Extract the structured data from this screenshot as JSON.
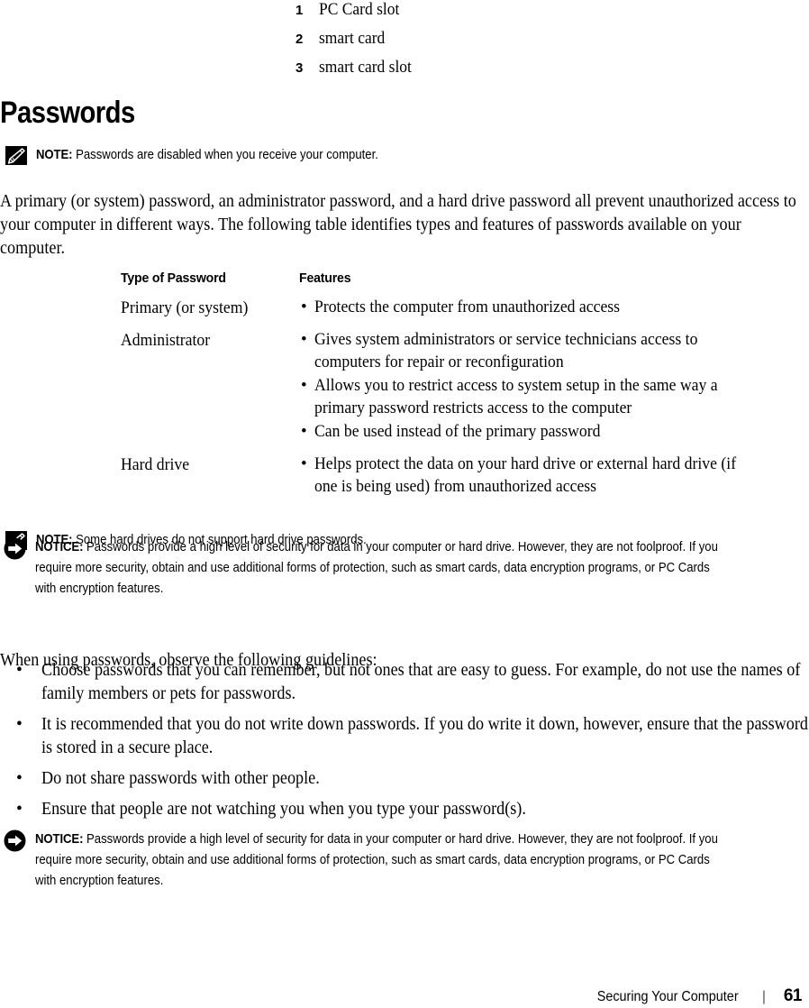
{
  "legend": {
    "items": [
      {
        "num": "1",
        "label": "PC Card slot"
      },
      {
        "num": "2",
        "label": "smart card"
      },
      {
        "num": "3",
        "label": "smart card slot"
      }
    ]
  },
  "section": {
    "heading": "Passwords"
  },
  "note_1": {
    "keyword": "NOTE:",
    "text": " Passwords are disabled when you receive your computer.",
    "icon": "note-pencil-icon"
  },
  "intro_paragraph": "A primary (or system) password, an administrator password, and a hard drive password all prevent unauthorized access to your computer in different ways. The following table identifies types and features of passwords available on your computer.",
  "password_table": {
    "headers": {
      "type": "Type of Password",
      "features": "Features"
    },
    "rows": [
      {
        "type": "Primary (or system)",
        "features": [
          "Protects the computer from unauthorized access"
        ]
      },
      {
        "type": "Administrator",
        "features": [
          "Gives system administrators or service technicians access to computers for repair or reconfiguration",
          "Allows you to restrict access to system setup in the same way a primary password restricts access to the computer",
          "Can be used instead of the primary password"
        ]
      },
      {
        "type": "Hard drive",
        "features": [
          "Helps protect the data on your hard drive or external hard drive (if one is being used) from unauthorized access"
        ]
      }
    ]
  },
  "note_2": {
    "keyword": "NOTE:",
    "text": " Some hard drives do not support hard drive passwords.",
    "icon": "note-pencil-icon"
  },
  "notice_1": {
    "keyword": "NOTICE:",
    "text": " Passwords provide a high level of security for data in your computer or hard drive. However, they are not foolproof. If you require more security, obtain and use additional forms of protection, such as smart cards, data encryption programs, or PC Cards with encryption features.",
    "icon": "notice-arrow-icon"
  },
  "guidelines_intro": "When using passwords, observe the following guidelines:",
  "guidelines": {
    "bullet": "•",
    "items": [
      "Choose passwords that you can remember, but not ones that are easy to guess. For example, do not use the names of family members or pets for passwords.",
      "It is recommended that you do not write down passwords. If you do write it down, however, ensure that the password is stored in a secure place.",
      "Do not share passwords with other people.",
      "Ensure that people are not watching you when you type your password(s)."
    ]
  },
  "notice_2": {
    "keyword": "NOTICE:",
    "text": " Passwords provide a high level of security for data in your computer or hard drive. However, they are not foolproof. If you require more security, obtain and use additional forms of protection, such as smart cards, data encryption programs, or PC Cards with encryption features.",
    "icon": "notice-arrow-icon"
  },
  "table_bullet": "•",
  "footer": {
    "title": "Securing Your Computer",
    "separator": "|",
    "page_number": "61"
  },
  "colors": {
    "text": "#000000",
    "background": "#ffffff",
    "icon": "#000000"
  }
}
